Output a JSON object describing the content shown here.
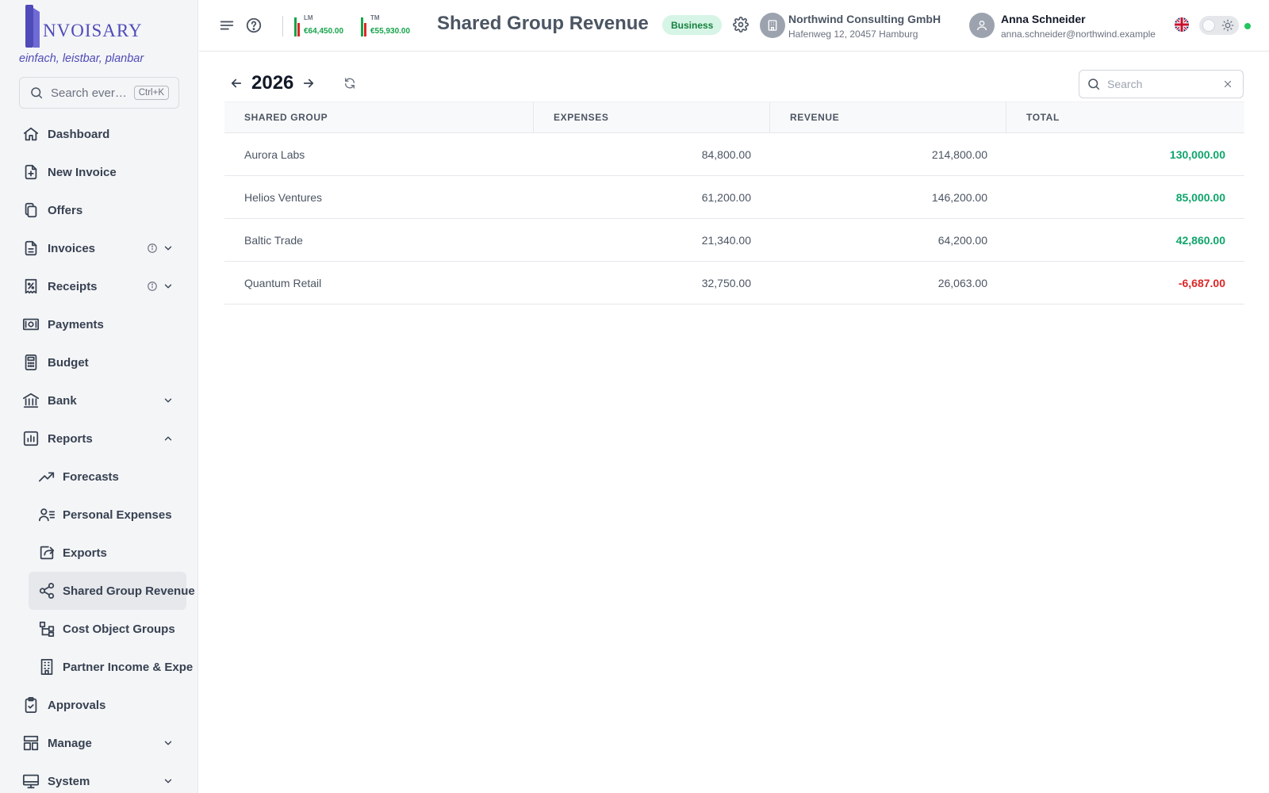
{
  "app": {
    "logo_text": "NVOISARY",
    "tagline": "einfach, leistbar, planbar"
  },
  "sidebar": {
    "search_placeholder": "Search ever…",
    "search_shortcut": "Ctrl+K",
    "items": [
      {
        "label": "Dashboard",
        "icon": "home-icon"
      },
      {
        "label": "New Invoice",
        "icon": "file-plus-icon"
      },
      {
        "label": "Offers",
        "icon": "copy-icon"
      },
      {
        "label": "Invoices",
        "icon": "file-text-icon",
        "info": true,
        "expanded": false
      },
      {
        "label": "Receipts",
        "icon": "receipt-percent-icon",
        "info": true,
        "expanded": false
      },
      {
        "label": "Payments",
        "icon": "banknote-icon"
      },
      {
        "label": "Budget",
        "icon": "calculator-icon"
      },
      {
        "label": "Bank",
        "icon": "bank-icon",
        "expanded": false
      },
      {
        "label": "Reports",
        "icon": "chart-icon",
        "expanded": true
      },
      {
        "label": "Forecasts",
        "icon": "trending-up-icon",
        "sub": true
      },
      {
        "label": "Personal Expenses",
        "icon": "user-list-icon",
        "sub": true
      },
      {
        "label": "Exports",
        "icon": "export-icon",
        "sub": true
      },
      {
        "label": "Shared Group Revenue",
        "icon": "share-icon",
        "sub": true,
        "active": true
      },
      {
        "label": "Cost Object Groups",
        "icon": "hierarchy-icon",
        "sub": true
      },
      {
        "label": "Partner Income & Expe",
        "icon": "building-icon",
        "sub": true
      },
      {
        "label": "Approvals",
        "icon": "clipboard-check-icon"
      },
      {
        "label": "Manage",
        "icon": "layout-icon",
        "expanded": false
      },
      {
        "label": "System",
        "icon": "monitor-icon",
        "expanded": false
      }
    ]
  },
  "header": {
    "kpi_lm_label": "LM",
    "kpi_lm_value": "€64,450.00",
    "kpi_tm_label": "TM",
    "kpi_tm_value": "€55,930.00",
    "title": "Shared Group Revenue",
    "badge": "Business",
    "org_name": "Northwind Consulting GmbH",
    "org_address": "Hafenweg 12, 20457 Hamburg",
    "user_name": "Anna Schneider",
    "user_email": "anna.schneider@northwind.example",
    "status_color": "#22c55e"
  },
  "main": {
    "year": "2026",
    "search_placeholder": "Search",
    "columns": [
      "Shared Group",
      "Expenses",
      "Revenue",
      "Total"
    ],
    "rows": [
      {
        "group": "Aurora Labs",
        "expenses": "84,800.00",
        "revenue": "214,800.00",
        "total": "130,000.00",
        "positive": true
      },
      {
        "group": "Helios Ventures",
        "expenses": "61,200.00",
        "revenue": "146,200.00",
        "total": "85,000.00",
        "positive": true
      },
      {
        "group": "Baltic Trade",
        "expenses": "21,340.00",
        "revenue": "64,200.00",
        "total": "42,860.00",
        "positive": true
      },
      {
        "group": "Quantum Retail",
        "expenses": "32,750.00",
        "revenue": "26,063.00",
        "total": "-6,687.00",
        "positive": false
      }
    ]
  },
  "colors": {
    "brand": "#4f4bb8",
    "positive": "#10a56c",
    "negative": "#dc2626",
    "badge_bg": "#d6f5e6"
  }
}
